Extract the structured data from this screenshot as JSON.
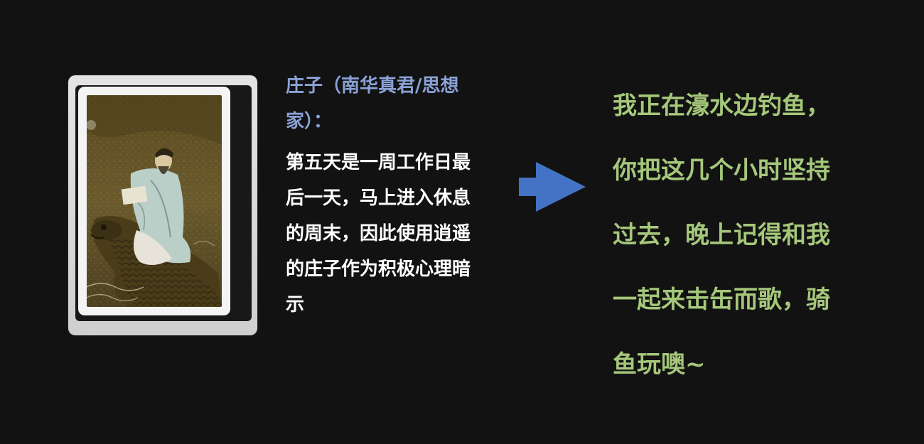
{
  "card": {
    "image_subject": "painting-zhuangzi-riding-carp",
    "colors": {
      "frame": "#f4f4f4",
      "painting_bg": "#5e4e22"
    }
  },
  "intro": {
    "heading_lines": [
      "庄子（南华真君/思想",
      "家）："
    ],
    "body_lines": [
      "第五天是一周工作日最",
      "后一天，马上进入休息",
      "的周末，因此使用逍遥",
      "的庄子作为积极心理暗",
      "示"
    ],
    "colors": {
      "heading": "#8aa2d6",
      "body": "#ffffff"
    }
  },
  "arrow": {
    "icon": "arrow-right-icon",
    "color": "#4472c4"
  },
  "quote": {
    "lines": [
      "我正在濠水边钓鱼，",
      "你把这几个小时坚持",
      "过去，晚上记得和我",
      "一起来击缶而歌，骑",
      "鱼玩噢~"
    ],
    "color": "#a5c77a"
  }
}
